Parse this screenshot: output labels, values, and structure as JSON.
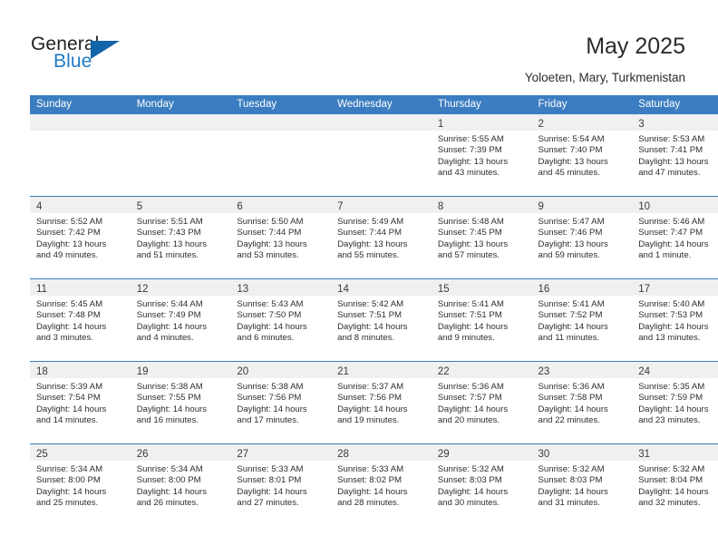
{
  "brand": {
    "name_top": "General",
    "name_bottom": "Blue",
    "flag_icon": "triangle-flag-icon",
    "color_top": "#231f20",
    "color_bottom": "#1f7ac4",
    "flag_color": "#1164a8"
  },
  "header": {
    "title": "May 2025",
    "subtitle": "Yoloeten, Mary, Turkmenistan"
  },
  "theme": {
    "header_bg": "#3b7dc0",
    "header_text": "#ffffff",
    "number_band_bg": "#f0f0f0",
    "cell_bg": "#ffffff",
    "row_divider": "#3b7dc0"
  },
  "calendar": {
    "weekday_headers": [
      "Sunday",
      "Monday",
      "Tuesday",
      "Wednesday",
      "Thursday",
      "Friday",
      "Saturday"
    ],
    "weeks": [
      [
        {
          "day": "",
          "lines": []
        },
        {
          "day": "",
          "lines": []
        },
        {
          "day": "",
          "lines": []
        },
        {
          "day": "",
          "lines": []
        },
        {
          "day": "1",
          "lines": [
            "Sunrise: 5:55 AM",
            "Sunset: 7:39 PM",
            "Daylight: 13 hours",
            "and 43 minutes."
          ]
        },
        {
          "day": "2",
          "lines": [
            "Sunrise: 5:54 AM",
            "Sunset: 7:40 PM",
            "Daylight: 13 hours",
            "and 45 minutes."
          ]
        },
        {
          "day": "3",
          "lines": [
            "Sunrise: 5:53 AM",
            "Sunset: 7:41 PM",
            "Daylight: 13 hours",
            "and 47 minutes."
          ]
        }
      ],
      [
        {
          "day": "4",
          "lines": [
            "Sunrise: 5:52 AM",
            "Sunset: 7:42 PM",
            "Daylight: 13 hours",
            "and 49 minutes."
          ]
        },
        {
          "day": "5",
          "lines": [
            "Sunrise: 5:51 AM",
            "Sunset: 7:43 PM",
            "Daylight: 13 hours",
            "and 51 minutes."
          ]
        },
        {
          "day": "6",
          "lines": [
            "Sunrise: 5:50 AM",
            "Sunset: 7:44 PM",
            "Daylight: 13 hours",
            "and 53 minutes."
          ]
        },
        {
          "day": "7",
          "lines": [
            "Sunrise: 5:49 AM",
            "Sunset: 7:44 PM",
            "Daylight: 13 hours",
            "and 55 minutes."
          ]
        },
        {
          "day": "8",
          "lines": [
            "Sunrise: 5:48 AM",
            "Sunset: 7:45 PM",
            "Daylight: 13 hours",
            "and 57 minutes."
          ]
        },
        {
          "day": "9",
          "lines": [
            "Sunrise: 5:47 AM",
            "Sunset: 7:46 PM",
            "Daylight: 13 hours",
            "and 59 minutes."
          ]
        },
        {
          "day": "10",
          "lines": [
            "Sunrise: 5:46 AM",
            "Sunset: 7:47 PM",
            "Daylight: 14 hours",
            "and 1 minute."
          ]
        }
      ],
      [
        {
          "day": "11",
          "lines": [
            "Sunrise: 5:45 AM",
            "Sunset: 7:48 PM",
            "Daylight: 14 hours",
            "and 3 minutes."
          ]
        },
        {
          "day": "12",
          "lines": [
            "Sunrise: 5:44 AM",
            "Sunset: 7:49 PM",
            "Daylight: 14 hours",
            "and 4 minutes."
          ]
        },
        {
          "day": "13",
          "lines": [
            "Sunrise: 5:43 AM",
            "Sunset: 7:50 PM",
            "Daylight: 14 hours",
            "and 6 minutes."
          ]
        },
        {
          "day": "14",
          "lines": [
            "Sunrise: 5:42 AM",
            "Sunset: 7:51 PM",
            "Daylight: 14 hours",
            "and 8 minutes."
          ]
        },
        {
          "day": "15",
          "lines": [
            "Sunrise: 5:41 AM",
            "Sunset: 7:51 PM",
            "Daylight: 14 hours",
            "and 9 minutes."
          ]
        },
        {
          "day": "16",
          "lines": [
            "Sunrise: 5:41 AM",
            "Sunset: 7:52 PM",
            "Daylight: 14 hours",
            "and 11 minutes."
          ]
        },
        {
          "day": "17",
          "lines": [
            "Sunrise: 5:40 AM",
            "Sunset: 7:53 PM",
            "Daylight: 14 hours",
            "and 13 minutes."
          ]
        }
      ],
      [
        {
          "day": "18",
          "lines": [
            "Sunrise: 5:39 AM",
            "Sunset: 7:54 PM",
            "Daylight: 14 hours",
            "and 14 minutes."
          ]
        },
        {
          "day": "19",
          "lines": [
            "Sunrise: 5:38 AM",
            "Sunset: 7:55 PM",
            "Daylight: 14 hours",
            "and 16 minutes."
          ]
        },
        {
          "day": "20",
          "lines": [
            "Sunrise: 5:38 AM",
            "Sunset: 7:56 PM",
            "Daylight: 14 hours",
            "and 17 minutes."
          ]
        },
        {
          "day": "21",
          "lines": [
            "Sunrise: 5:37 AM",
            "Sunset: 7:56 PM",
            "Daylight: 14 hours",
            "and 19 minutes."
          ]
        },
        {
          "day": "22",
          "lines": [
            "Sunrise: 5:36 AM",
            "Sunset: 7:57 PM",
            "Daylight: 14 hours",
            "and 20 minutes."
          ]
        },
        {
          "day": "23",
          "lines": [
            "Sunrise: 5:36 AM",
            "Sunset: 7:58 PM",
            "Daylight: 14 hours",
            "and 22 minutes."
          ]
        },
        {
          "day": "24",
          "lines": [
            "Sunrise: 5:35 AM",
            "Sunset: 7:59 PM",
            "Daylight: 14 hours",
            "and 23 minutes."
          ]
        }
      ],
      [
        {
          "day": "25",
          "lines": [
            "Sunrise: 5:34 AM",
            "Sunset: 8:00 PM",
            "Daylight: 14 hours",
            "and 25 minutes."
          ]
        },
        {
          "day": "26",
          "lines": [
            "Sunrise: 5:34 AM",
            "Sunset: 8:00 PM",
            "Daylight: 14 hours",
            "and 26 minutes."
          ]
        },
        {
          "day": "27",
          "lines": [
            "Sunrise: 5:33 AM",
            "Sunset: 8:01 PM",
            "Daylight: 14 hours",
            "and 27 minutes."
          ]
        },
        {
          "day": "28",
          "lines": [
            "Sunrise: 5:33 AM",
            "Sunset: 8:02 PM",
            "Daylight: 14 hours",
            "and 28 minutes."
          ]
        },
        {
          "day": "29",
          "lines": [
            "Sunrise: 5:32 AM",
            "Sunset: 8:03 PM",
            "Daylight: 14 hours",
            "and 30 minutes."
          ]
        },
        {
          "day": "30",
          "lines": [
            "Sunrise: 5:32 AM",
            "Sunset: 8:03 PM",
            "Daylight: 14 hours",
            "and 31 minutes."
          ]
        },
        {
          "day": "31",
          "lines": [
            "Sunrise: 5:32 AM",
            "Sunset: 8:04 PM",
            "Daylight: 14 hours",
            "and 32 minutes."
          ]
        }
      ]
    ]
  }
}
